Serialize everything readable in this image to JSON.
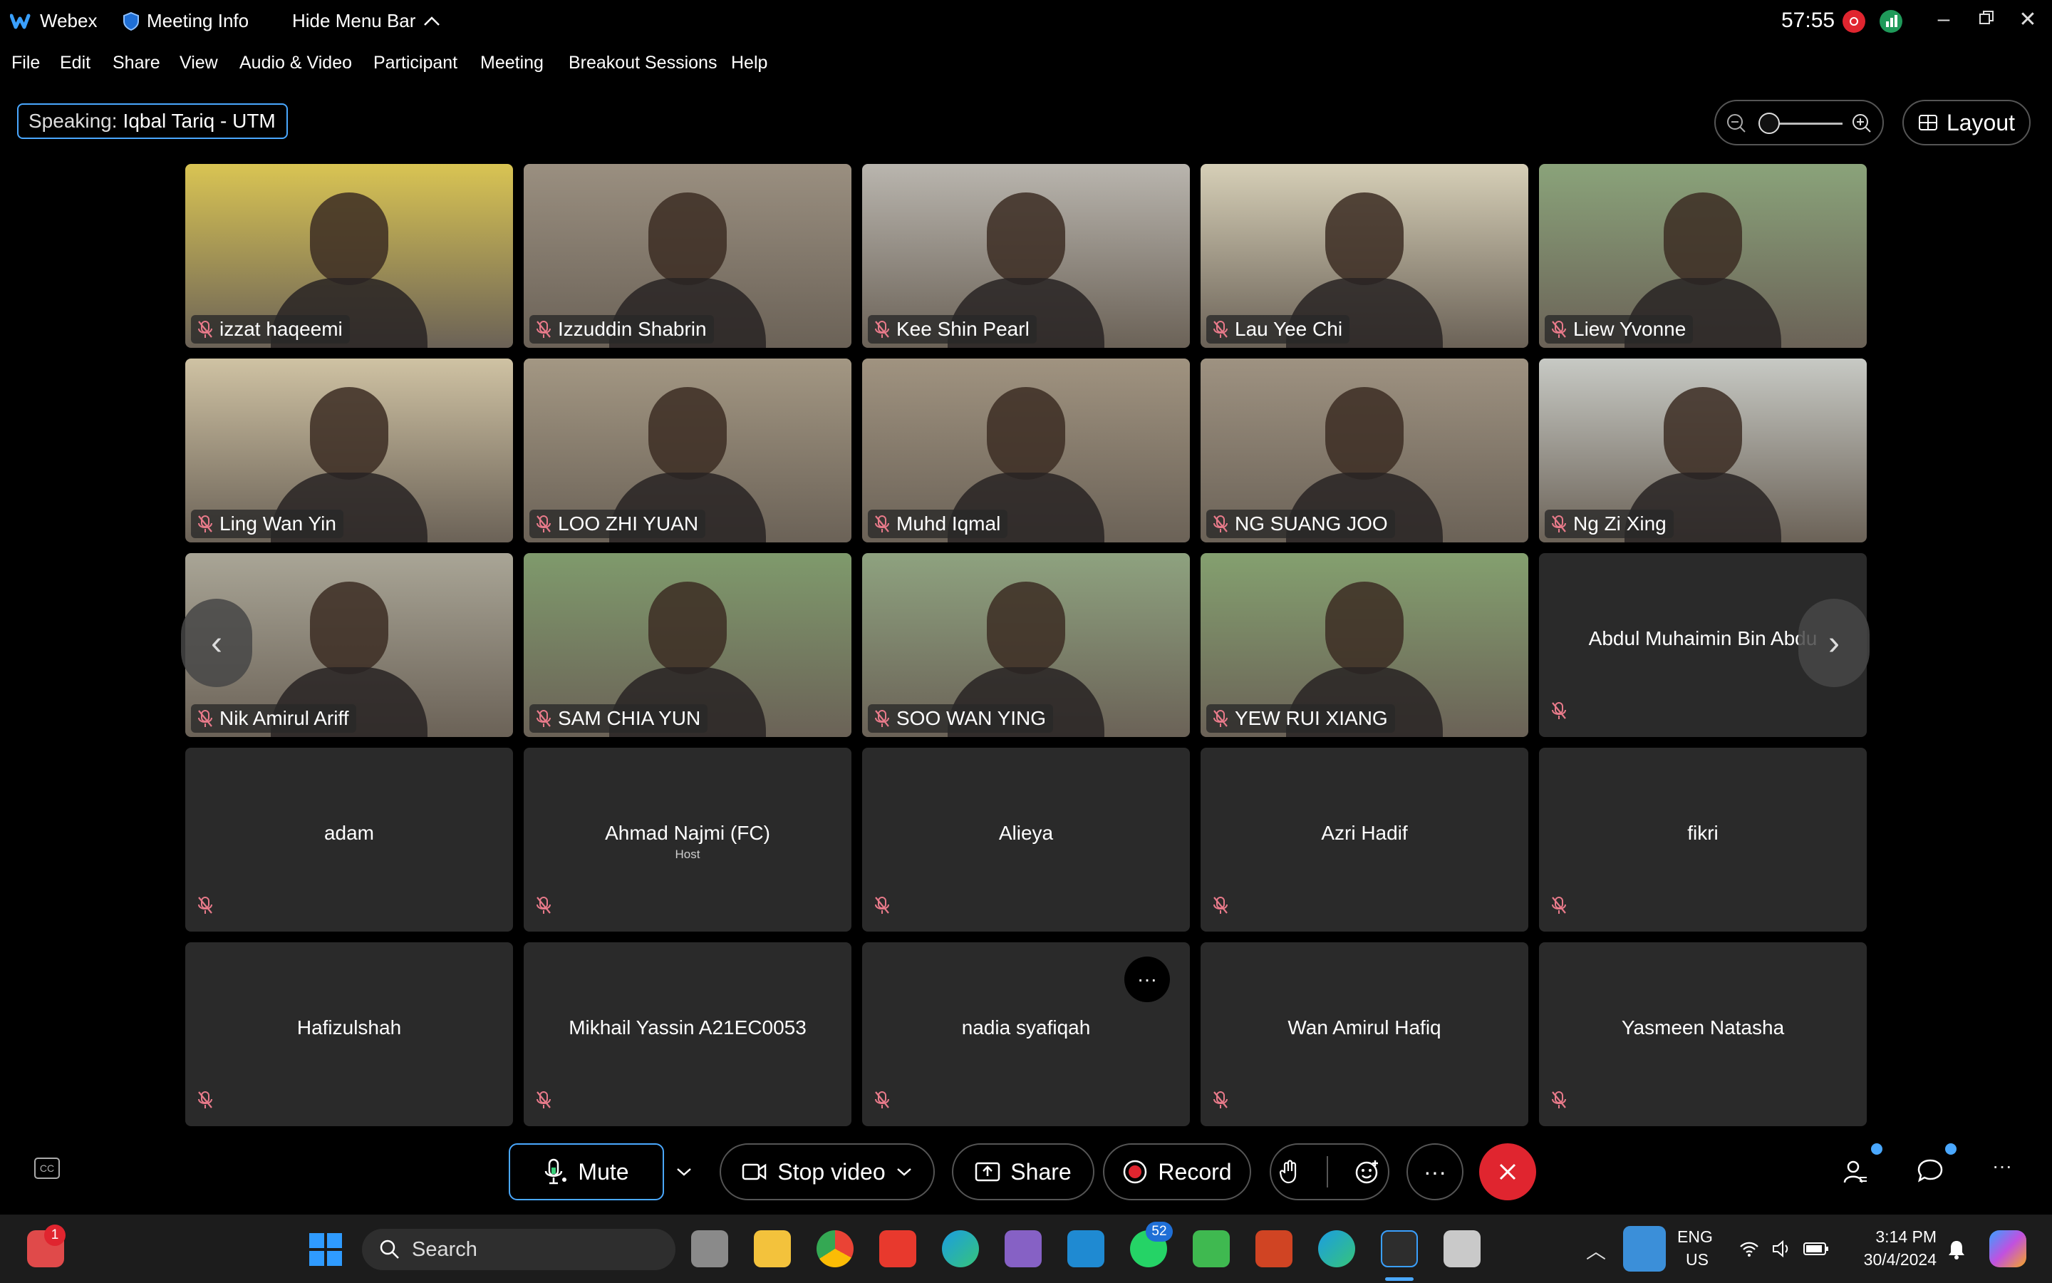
{
  "titlebar": {
    "app_name": "Webex",
    "meeting_info": "Meeting Info",
    "hide_menu_bar": "Hide Menu Bar",
    "timer": "57:55"
  },
  "menu": [
    "File",
    "Edit",
    "Share",
    "View",
    "Audio & Video",
    "Participant",
    "Meeting",
    "Breakout Sessions",
    "Help"
  ],
  "speaking": {
    "label": "Speaking:",
    "name": "Iqbal Tariq - UTM"
  },
  "layout_label": "Layout",
  "video_tiles": [
    {
      "name": "izzat haqeemi",
      "bg": "#d9c453"
    },
    {
      "name": "Izzuddin Shabrin",
      "bg": "#9a8f80"
    },
    {
      "name": "Kee Shin Pearl",
      "bg": "#b9b5ae"
    },
    {
      "name": "Lau Yee Chi",
      "bg": "#d6cfb7"
    },
    {
      "name": "Liew Yvonne",
      "bg": "#8aa37a"
    },
    {
      "name": "Ling Wan Yin",
      "bg": "#cfc2a3"
    },
    {
      "name": "LOO ZHI YUAN",
      "bg": "#a39783"
    },
    {
      "name": "Muhd Iqmal",
      "bg": "#a09380"
    },
    {
      "name": "NG SUANG JOO",
      "bg": "#9e9281"
    },
    {
      "name": "Ng Zi Xing",
      "bg": "#c7c9c4"
    },
    {
      "name": "Nik Amirul Ariff",
      "bg": "#a9a596"
    },
    {
      "name": "SAM CHIA YUN",
      "bg": "#7f9a6c"
    },
    {
      "name": "SOO WAN YING",
      "bg": "#8ea27f"
    },
    {
      "name": "YEW RUI XIANG",
      "bg": "#84a06f"
    }
  ],
  "audio_tiles": [
    {
      "name": "Abdul Muhaimin Bin Abdu",
      "sub": ""
    },
    {
      "name": "adam",
      "sub": ""
    },
    {
      "name": "Ahmad Najmi (FC)",
      "sub": "Host"
    },
    {
      "name": "Alieya",
      "sub": ""
    },
    {
      "name": "Azri Hadif",
      "sub": ""
    },
    {
      "name": "fikri",
      "sub": ""
    },
    {
      "name": "Hafizulshah",
      "sub": ""
    },
    {
      "name": "Mikhail Yassin A21EC0053",
      "sub": ""
    },
    {
      "name": "nadia syafiqah",
      "sub": ""
    },
    {
      "name": "Wan Amirul Hafiq",
      "sub": ""
    },
    {
      "name": "Yasmeen Natasha",
      "sub": ""
    }
  ],
  "controls": {
    "mute": "Mute",
    "stop_video": "Stop video",
    "share": "Share",
    "record": "Record",
    "more": "···"
  },
  "taskbar": {
    "search_placeholder": "Search",
    "notification_badge": "1",
    "whatsapp_badge": "52",
    "lang_top": "ENG",
    "lang_bottom": "US",
    "time": "3:14 PM",
    "date": "30/4/2024"
  },
  "colors": {
    "accent": "#4aa8ff",
    "end_call": "#e0252f",
    "record_dot": "#e0252f",
    "mute_icon": "#e87a8a"
  }
}
